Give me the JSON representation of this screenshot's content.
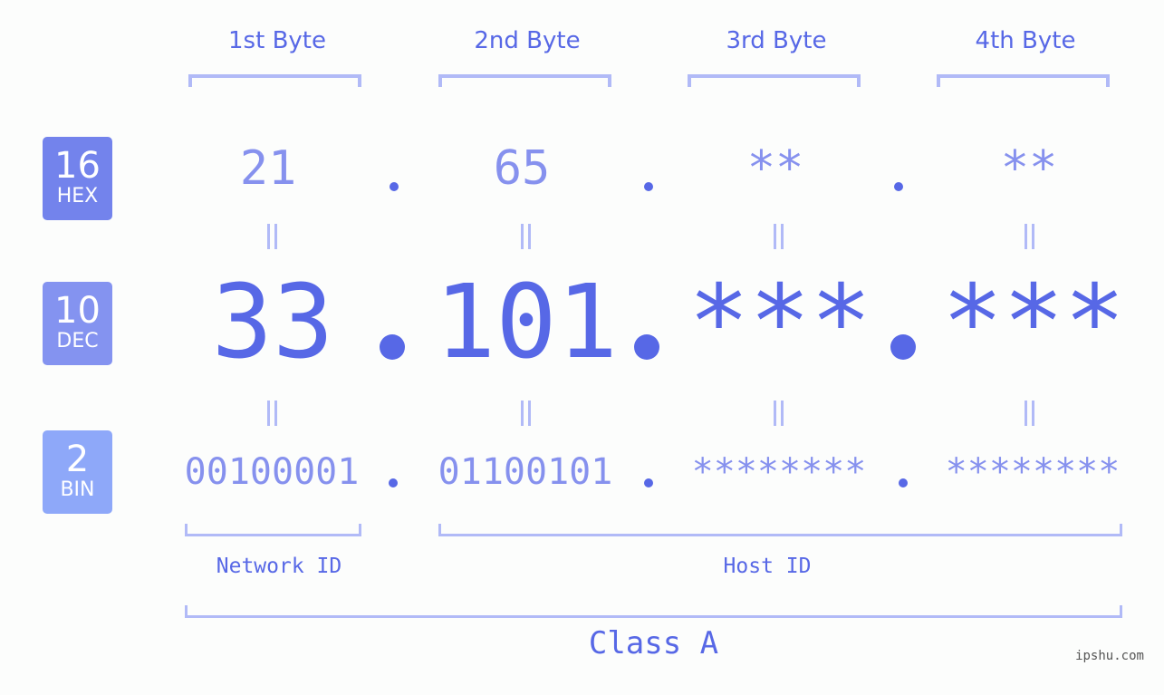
{
  "headers": [
    "1st Byte",
    "2nd Byte",
    "3rd Byte",
    "4th Byte"
  ],
  "badges": {
    "hex": {
      "number": "16",
      "label": "HEX",
      "color": "#7383ec"
    },
    "dec": {
      "number": "10",
      "label": "DEC",
      "color": "#8493f0"
    },
    "bin": {
      "number": "2",
      "label": "BIN",
      "color": "#8ea8f9"
    }
  },
  "hex_values": [
    "21",
    "65",
    "**",
    "**"
  ],
  "dec_values": [
    "33",
    "101",
    "***",
    "***"
  ],
  "bin_values": [
    "00100001",
    "01100101",
    "********",
    "********"
  ],
  "network_id_label": "Network ID",
  "host_id_label": "Host ID",
  "class_label": "Class A",
  "watermark": "ipshu.com",
  "colors": {
    "primary": "#5768e6",
    "secondary": "#8691ee",
    "bracket": "#b1baf7",
    "background": "#fcfdfc"
  }
}
